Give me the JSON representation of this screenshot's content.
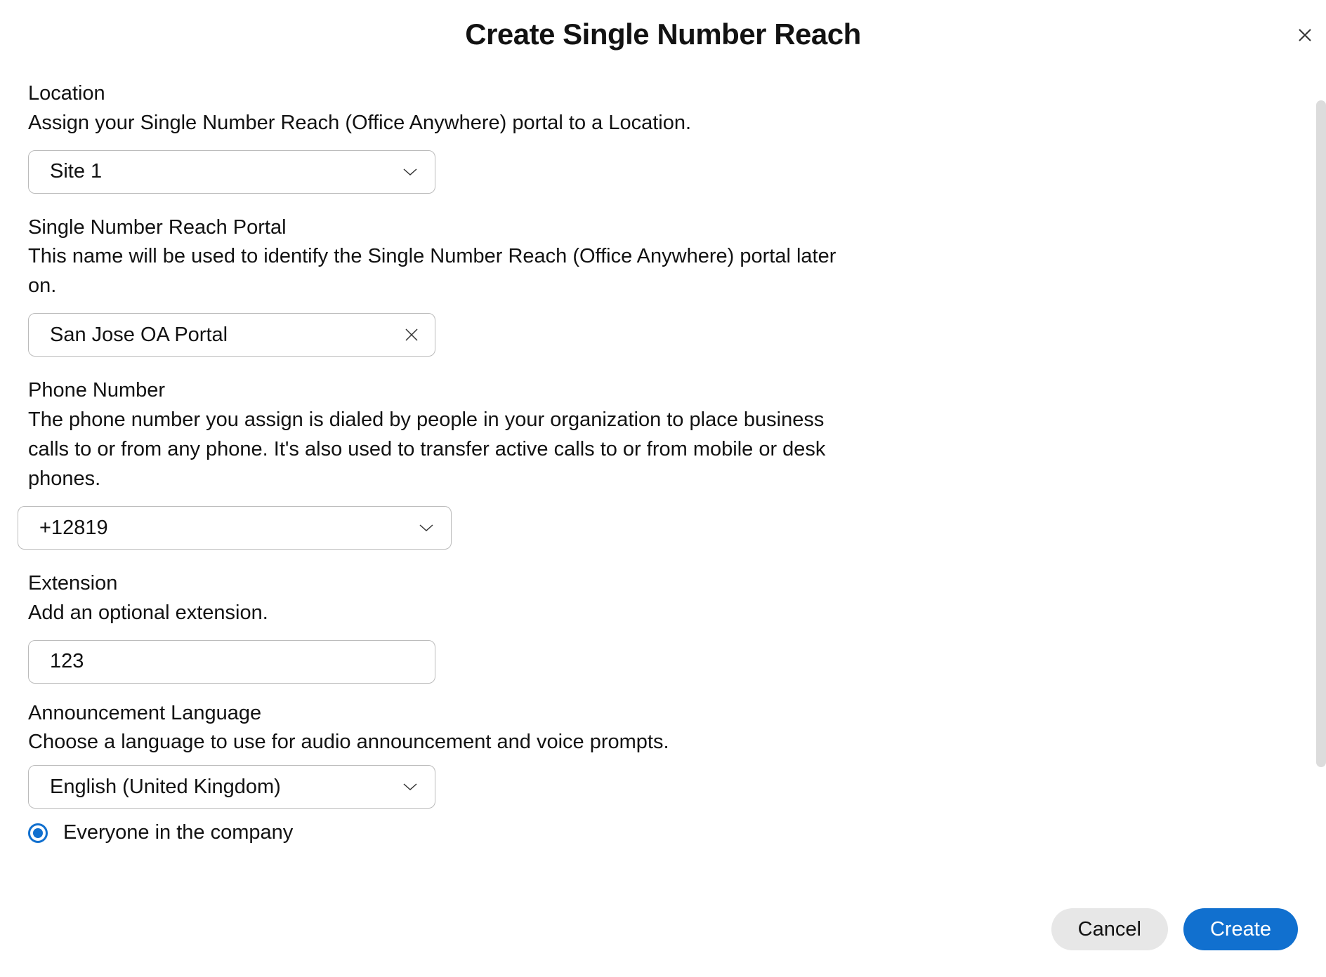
{
  "header": {
    "title": "Create Single Number Reach"
  },
  "fields": {
    "location": {
      "label": "Location",
      "description": "Assign your Single Number Reach (Office Anywhere) portal to a Location.",
      "value": "Site 1"
    },
    "portal": {
      "label": "Single Number Reach Portal",
      "description": "This name will be used to identify the Single Number Reach (Office Anywhere) portal later on.",
      "value": "San Jose OA Portal"
    },
    "phone": {
      "label": "Phone Number",
      "description": "The phone number you assign is dialed by people in your organization to place business calls to or from any phone. It's also used to transfer active calls to or from mobile or desk phones.",
      "value": "+12819"
    },
    "extension": {
      "label": "Extension",
      "description": "Add an optional extension.",
      "value": "123"
    },
    "language": {
      "label": "Announcement Language",
      "description": "Choose a language to use for audio announcement and voice prompts.",
      "value": "English (United Kingdom)"
    },
    "scope": {
      "option1": "Everyone in the company"
    }
  },
  "footer": {
    "cancel": "Cancel",
    "create": "Create"
  }
}
